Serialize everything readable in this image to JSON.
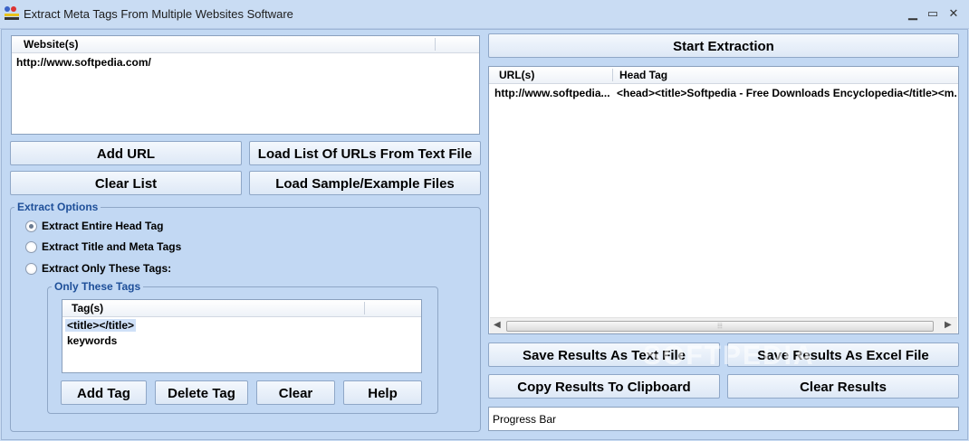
{
  "window": {
    "title": "Extract Meta Tags From Multiple Websites Software",
    "minimize_glyph": "▁",
    "maximize_glyph": "▭",
    "close_glyph": "✕"
  },
  "websites": {
    "header": "Website(s)",
    "items": [
      "http://www.softpedia.com/"
    ]
  },
  "buttons": {
    "add_url": "Add URL",
    "load_list": "Load List Of URLs From Text File",
    "clear_list": "Clear List",
    "load_sample": "Load Sample/Example Files",
    "start_extraction": "Start Extraction",
    "save_text": "Save Results As Text File",
    "save_excel": "Save Results As Excel File",
    "copy_clipboard": "Copy Results To Clipboard",
    "clear_results": "Clear Results",
    "add_tag": "Add Tag",
    "delete_tag": "Delete Tag",
    "clear": "Clear",
    "help": "Help"
  },
  "extract_options": {
    "legend": "Extract Options",
    "options": [
      {
        "label": "Extract Entire Head Tag",
        "selected": true
      },
      {
        "label": "Extract Title and Meta Tags",
        "selected": false
      },
      {
        "label": "Extract Only These Tags:",
        "selected": false
      }
    ]
  },
  "only_tags": {
    "legend": "Only These Tags",
    "header": "Tag(s)",
    "items": [
      "<title></title>",
      "keywords"
    ]
  },
  "results": {
    "columns": [
      "URL(s)",
      "Head Tag"
    ],
    "rows": [
      {
        "url": "http://www.softpedia...",
        "head": "<head><title>Softpedia - Free Downloads Encyclopedia</title><m..."
      }
    ],
    "scroll_left": "◀",
    "scroll_right": "▶",
    "thumb_grip": "⦙⦙⦙"
  },
  "progress": {
    "label": "Progress Bar"
  },
  "watermark": "SOFTPEDIA",
  "colors": {
    "background": "#c2d8f3",
    "legend_text": "#1e4f99",
    "selection": "#cfe0f7"
  }
}
